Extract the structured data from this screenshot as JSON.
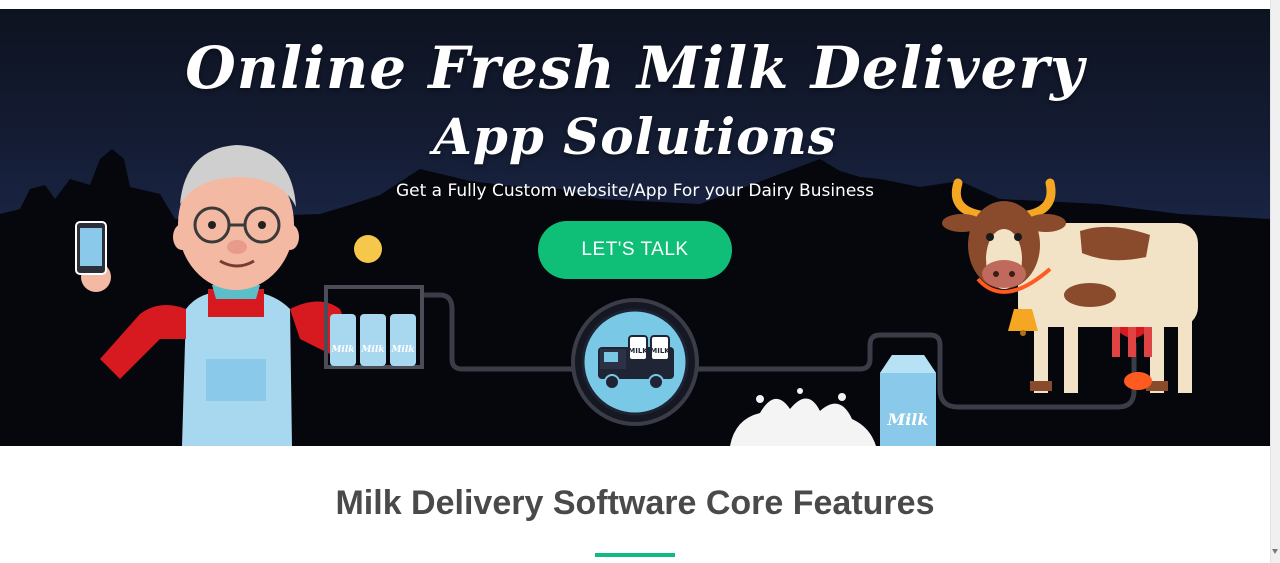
{
  "hero": {
    "title_line1": "Online Fresh Milk Delivery",
    "title_line2": "App Solutions",
    "subtitle": "Get a Fully Custom website/App For your Dairy Business",
    "cta_label": "LET'S TALK",
    "bottle_label": "Milk",
    "truck_crate_label": "MILK",
    "carton_label": "Milk"
  },
  "features": {
    "title": "Milk Delivery Software Core Features"
  },
  "colors": {
    "accent_green": "#0fbf78",
    "underline_green": "#12b981",
    "heading_gray": "#4a4a4a"
  },
  "icons": [
    "smartphone-icon",
    "delivery-truck-icon",
    "cow-icon",
    "milk-bottle-icon",
    "milk-carton-icon",
    "milk-splash-icon",
    "cowbell-icon"
  ]
}
